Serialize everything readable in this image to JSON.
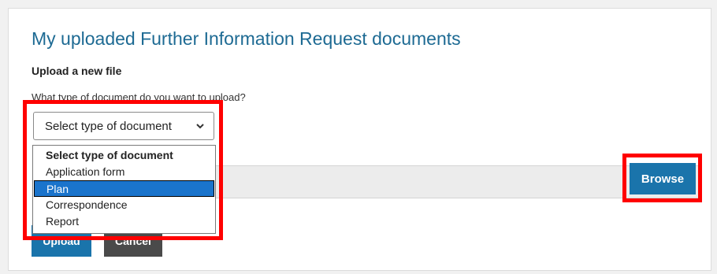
{
  "page": {
    "title": "My uploaded Further Information Request documents",
    "subheading": "Upload a new file",
    "question": "What type of document do you want to upload?"
  },
  "document_type": {
    "selected_value": "Select type of document",
    "options": [
      "Select type of document",
      "Application form",
      "Plan",
      "Correspondence",
      "Report"
    ],
    "highlighted_option": "Plan"
  },
  "actions": {
    "browse_label": "Browse",
    "upload_label": "Upload",
    "cancel_label": "Cancel"
  },
  "icons": {
    "select_arrow": "chevron-down-icon"
  },
  "colors": {
    "title": "#1d6a93",
    "primary_button": "#1a74ab",
    "cancel_button": "#4a4a4a",
    "highlight_box": "#ff0000",
    "option_selected": "#1a74cc"
  }
}
